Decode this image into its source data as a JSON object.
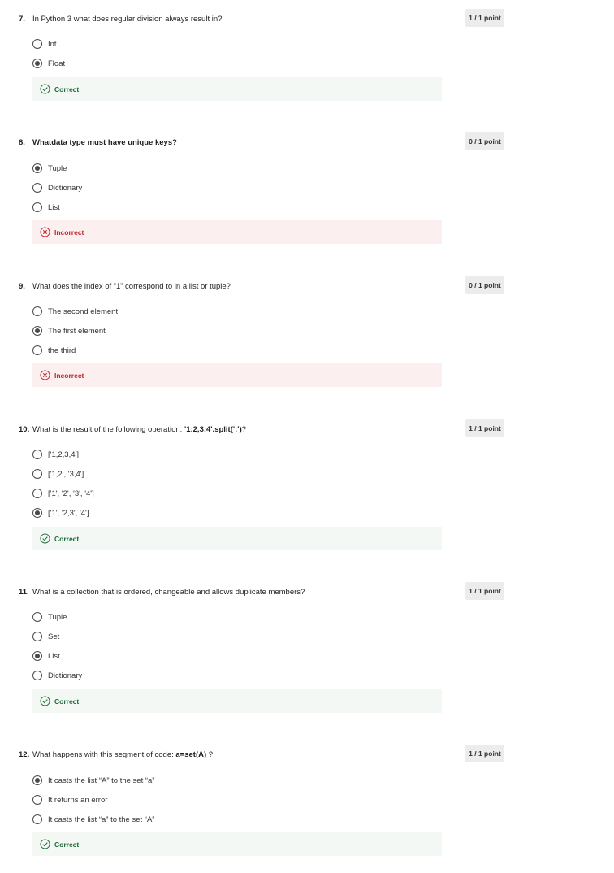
{
  "colors": {
    "correct": "#1f6b3a",
    "incorrect": "#c4262e",
    "correct_bg": "#f3f8f4",
    "incorrect_bg": "#fcefef"
  },
  "questions": [
    {
      "number": "7.",
      "text": "In Python 3 what does regular division always result in?",
      "points": "1 / 1 point",
      "options": [
        {
          "label": "Int",
          "selected": false
        },
        {
          "label": "Float",
          "selected": true
        }
      ],
      "feedback": {
        "status": "Correct",
        "icon": "check-circle-icon"
      }
    },
    {
      "number": "8.",
      "text": "Whatdata type must have unique keys?",
      "points": "0 / 1 point",
      "options": [
        {
          "label": "Tuple",
          "selected": true
        },
        {
          "label": "Dictionary",
          "selected": false
        },
        {
          "label": "List",
          "selected": false
        }
      ],
      "feedback": {
        "status": "Incorrect",
        "icon": "x-circle-icon"
      }
    },
    {
      "number": "9.",
      "text": "What does the index of “1” correspond to in a list or tuple?",
      "points": "0 / 1 point",
      "options": [
        {
          "label": "The second element",
          "selected": false
        },
        {
          "label": "The first element",
          "selected": true
        },
        {
          "label": "the third",
          "selected": false
        }
      ],
      "feedback": {
        "status": "Incorrect",
        "icon": "x-circle-icon"
      }
    },
    {
      "number": "10.",
      "text_prefix": "What is the result of the following operation: ",
      "text_code": "'1:2,3:4'.split(':')",
      "text_suffix": "?",
      "points": "1 / 1 point",
      "options": [
        {
          "label": "['1,2,3,4']",
          "selected": false
        },
        {
          "label": "['1,2', '3,4']",
          "selected": false
        },
        {
          "label": "['1', '2', '3', '4']",
          "selected": false
        },
        {
          "label": "['1', '2,3', '4']",
          "selected": true
        }
      ],
      "feedback": {
        "status": "Correct",
        "icon": "check-circle-icon"
      }
    },
    {
      "number": "11.",
      "text": "What is a collection that is ordered, changeable and allows duplicate members?",
      "points": "1 / 1 point",
      "options": [
        {
          "label": "Tuple",
          "selected": false
        },
        {
          "label": "Set",
          "selected": false
        },
        {
          "label": "List",
          "selected": true
        },
        {
          "label": "Dictionary",
          "selected": false
        }
      ],
      "feedback": {
        "status": "Correct",
        "icon": "check-circle-icon"
      }
    },
    {
      "number": "12.",
      "text_prefix": "What happens with this segment of code: ",
      "text_code": "a=set(A)",
      "text_suffix": " ?",
      "points": "1 / 1 point",
      "options": [
        {
          "label": "It casts the list “A” to the set “a”",
          "selected": true
        },
        {
          "label": "It returns an error",
          "selected": false
        },
        {
          "label": "It casts the list “a” to the set “A”",
          "selected": false
        }
      ],
      "feedback": {
        "status": "Correct",
        "icon": "check-circle-icon"
      }
    }
  ]
}
